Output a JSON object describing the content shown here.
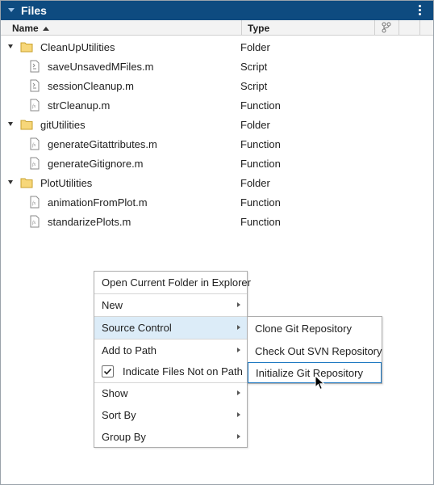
{
  "panel": {
    "title": "Files",
    "icons": {
      "collapse": "collapse-arrow-icon",
      "menu": "vertical-ellipsis-icon"
    }
  },
  "columns": {
    "name": "Name",
    "type": "Type",
    "sort_icon": "sort-ascending-icon",
    "source_control_icon": "git-branch-icon"
  },
  "tree": [
    {
      "label": "CleanUpUtilities",
      "type": "Folder",
      "kind": "folder",
      "expanded": true
    },
    {
      "label": "saveUnsavedMFiles.m",
      "type": "Script",
      "kind": "script"
    },
    {
      "label": "sessionCleanup.m",
      "type": "Script",
      "kind": "script"
    },
    {
      "label": "strCleanup.m",
      "type": "Function",
      "kind": "function"
    },
    {
      "label": "gitUtilities",
      "type": "Folder",
      "kind": "folder",
      "expanded": true
    },
    {
      "label": "generateGitattributes.m",
      "type": "Function",
      "kind": "function"
    },
    {
      "label": "generateGitignore.m",
      "type": "Function",
      "kind": "function"
    },
    {
      "label": "PlotUtilities",
      "type": "Folder",
      "kind": "folder",
      "expanded": true
    },
    {
      "label": "animationFromPlot.m",
      "type": "Function",
      "kind": "function"
    },
    {
      "label": "standarizePlots.m",
      "type": "Function",
      "kind": "function"
    }
  ],
  "context_menu": {
    "open_explorer": "Open Current Folder in Explorer",
    "new": "New",
    "source_control": "Source Control",
    "add_to_path": "Add to Path",
    "indicate_files": "Indicate Files Not on Path",
    "indicate_files_checked": true,
    "show": "Show",
    "sort_by": "Sort By",
    "group_by": "Group By"
  },
  "submenu": {
    "clone": "Clone Git Repository",
    "checkout": "Check Out SVN Repository",
    "initialize": "Initialize Git Repository"
  },
  "colors": {
    "titlebar": "#0e4b80",
    "folder": "#f0c24b",
    "highlight": "#1f79c2"
  }
}
